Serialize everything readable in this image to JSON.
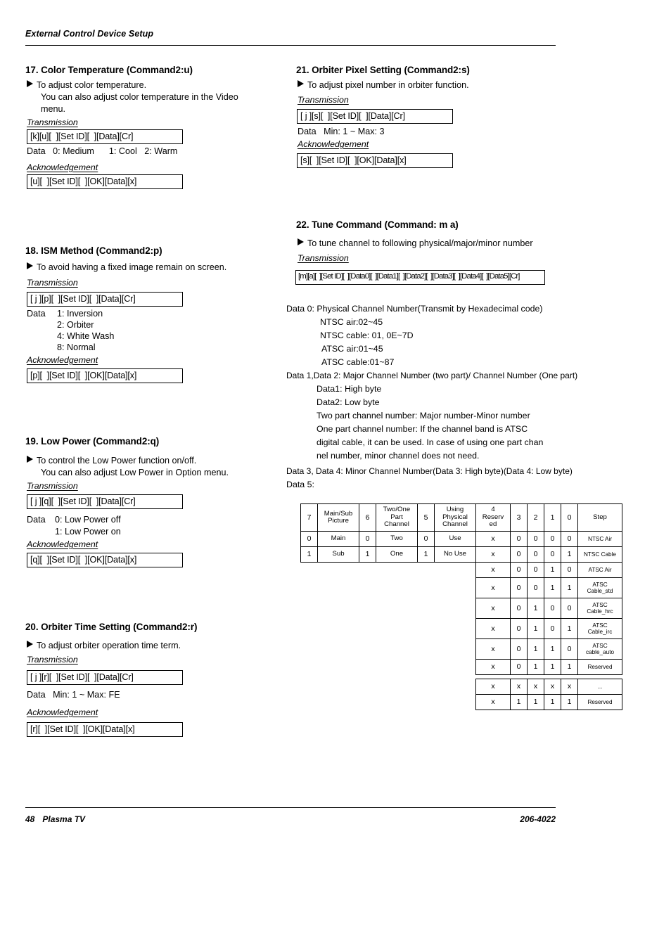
{
  "header": {
    "title": "External Control Device Setup"
  },
  "footer": {
    "page_number": "48",
    "product": "Plasma TV",
    "doc_code": "206-4022"
  },
  "sections": {
    "s17": {
      "title": "17. Color Temperature (Command2:u)",
      "bullet_line1": "To adjust color temperature.",
      "bullet_line2": "You can also adjust color temperature in the Video",
      "bullet_line3": "menu.",
      "transmission_label": "Transmission",
      "transmission_code": "[k][u][  ][Set ID][  ][Data][Cr]",
      "data_note": "Data   0: Medium      1: Cool   2: Warm",
      "ack_label": "Acknowledgement",
      "ack_code": "[u][  ][Set ID][  ][OK][Data][x]"
    },
    "s18": {
      "title": "18. ISM Method (Command2:p)",
      "bullet_line1": "To avoid having a fixed image remain on screen.",
      "transmission_label": "Transmission",
      "transmission_code": "[ j ][p][  ][Set ID][  ][Data][Cr]",
      "data_label": "Data",
      "data_options": [
        "1: Inversion",
        "2: Orbiter",
        "4: White Wash",
        "8: Normal"
      ],
      "ack_label": "Acknowledgement",
      "ack_code": "[p][  ][Set ID][  ][OK][Data][x]"
    },
    "s19": {
      "title": "19. Low Power (Command2:q)",
      "bullet_line1": "To control the Low Power function on/off.",
      "bullet_line2": "You can also adjust Low Power in Option menu.",
      "transmission_label": "Transmission",
      "transmission_code": "[ j ][q][  ][Set ID][  ][Data][Cr]",
      "data_label": "Data",
      "data_options": [
        "0: Low Power off",
        "1: Low Power on"
      ],
      "ack_label": "Acknowledgement",
      "ack_code": "[q][  ][Set ID][  ][OK][Data][x]"
    },
    "s20": {
      "title": "20. Orbiter Time Setting (Command2:r)",
      "bullet_line1": "To adjust orbiter operation time term.",
      "transmission_label": "Transmission",
      "transmission_code": "[ j ][r][  ][Set ID][  ][Data][Cr]",
      "data_note": "Data   Min: 1 ~ Max: FE",
      "ack_label": "Acknowledgement",
      "ack_code": "[r][  ][Set ID][  ][OK][Data][x]"
    },
    "s21": {
      "title": "21. Orbiter Pixel Setting (Command2:s)",
      "bullet_line1": "To adjust pixel number in orbiter function.",
      "transmission_label": "Transmission",
      "transmission_code": "[ j ][s][  ][Set ID][  ][Data][Cr]",
      "data_note": "Data   Min: 1 ~ Max: 3",
      "ack_label": "Acknowledgement",
      "ack_code": "[s][  ][Set ID][  ][OK][Data][x]"
    },
    "s22": {
      "title": "22. Tune Command (Command: m a)",
      "bullet_line1": "To tune channel to following physical/major/minor number",
      "transmission_label": "Transmission",
      "transmission_code": "[m][a][  ][Set ID][  ][Data0][  ][Data1][  ][Data2][  ][Data3][  ][Data4][  ][Data5][Cr]",
      "data0_title": "Data   0: Physical Channel Number(Transmit by Hexadecimal code)",
      "data0_items": [
        "NTSC air:02~45",
        "NTSC cable: 01, 0E~7D",
        "ATSC air:01~45",
        "ATSC cable:01~87"
      ],
      "data12_title": "Data 1,Data 2: Major Channel Number (two part)/ Channel Number (One part)",
      "data12_items": [
        "Data1: High byte",
        "Data2: Low byte",
        "Two part channel number: Major number-Minor number",
        "One part channel number: If the channel band is ATSC",
        "digital cable, it can be used. In case of using one part chan",
        "nel number, minor channel does not need."
      ],
      "data34_title": "Data 3, Data 4: Minor Channel Number(Data 3: High byte)(Data 4: Low byte)",
      "data5_title": "Data 5:"
    }
  },
  "data5_table": {
    "type": "table",
    "header": [
      "7",
      "Main/Sub\nPicture",
      "6",
      "Two/One\nPart\nChannel",
      "5",
      "Using\nPhysical\nChannel",
      "4\nReserv\ned",
      "3",
      "2",
      "1",
      "0",
      "Step"
    ],
    "rows": [
      [
        "0",
        "Main",
        "0",
        "Two",
        "0",
        "Use",
        "x",
        "0",
        "0",
        "0",
        "0",
        "NTSC Air"
      ],
      [
        "1",
        "Sub",
        "1",
        "One",
        "1",
        "No Use",
        "x",
        "0",
        "0",
        "0",
        "1",
        "NTSC Cable"
      ]
    ],
    "tail_rows": [
      [
        "x",
        "0",
        "0",
        "1",
        "0",
        "ATSC Air"
      ],
      [
        "x",
        "0",
        "0",
        "1",
        "1",
        "ATSC\nCable_std"
      ],
      [
        "x",
        "0",
        "1",
        "0",
        "0",
        "ATSC\nCable_hrc"
      ],
      [
        "x",
        "0",
        "1",
        "0",
        "1",
        "ATSC\nCable_irc"
      ],
      [
        "x",
        "0",
        "1",
        "1",
        "0",
        "ATSC\ncable_auto"
      ],
      [
        "x",
        "0",
        "1",
        "1",
        "1",
        "Reserved"
      ]
    ],
    "final_rows": [
      [
        "x",
        "x",
        "x",
        "x",
        "x",
        "..."
      ],
      [
        "x",
        "1",
        "1",
        "1",
        "1",
        "Reserved"
      ]
    ]
  }
}
